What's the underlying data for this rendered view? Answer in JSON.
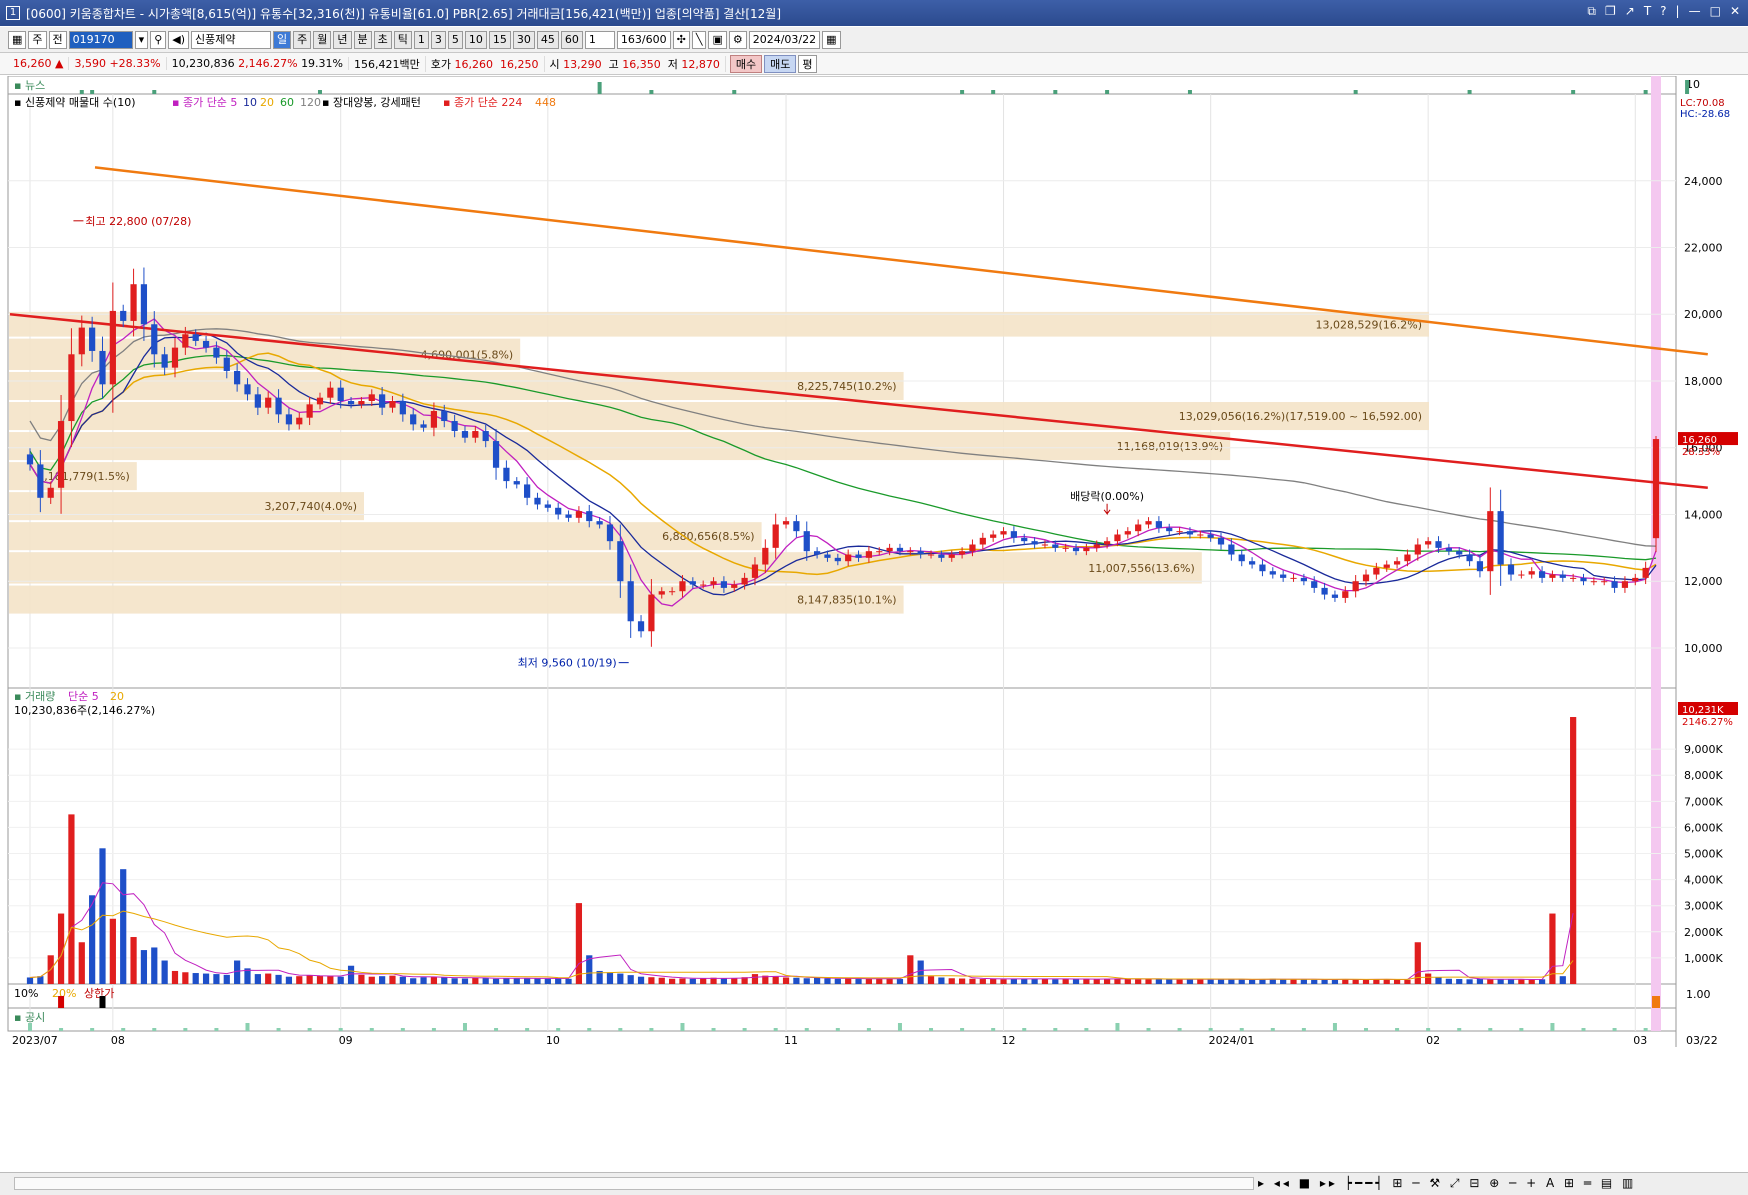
{
  "title": {
    "screen_num": "1",
    "text": "[0600] 키움종합차트 - 시가총액[8,615(억)] 유통수[32,316(천)] 유통비율[61.0] PBR[2.65] 거래대금[156,421(백만)] 업종[의약품] 결산[12월]"
  },
  "toolbar": {
    "type": "주",
    "range": "전",
    "code": "019170",
    "name": "신풍제약",
    "periods": [
      "일",
      "주",
      "월",
      "년",
      "분",
      "초",
      "틱"
    ],
    "active_period": "일",
    "intervals": [
      "1",
      "3",
      "5",
      "10",
      "15",
      "30",
      "45",
      "60"
    ],
    "multiplier": "1",
    "count": "163",
    "count_max": "/600",
    "date": "2024/03/22"
  },
  "quote": {
    "price": "16,260",
    "arrow": "▲",
    "change": "3,590",
    "change_pct": "+28.33%",
    "volume": "10,230,836",
    "vol_pct": "2,146.27%",
    "turnover": "19.31%",
    "amount": "156,421백만",
    "hoga_label": "호가",
    "ask": "16,260",
    "bid": "16,250",
    "open_label": "시",
    "open": "13,290",
    "high_label": "고",
    "high": "16,350",
    "low_label": "저",
    "low": "12,870",
    "buy": "매수",
    "sell": "매도",
    "p": "평"
  },
  "panels": {
    "news_label": "뉴스",
    "news_axis": "10",
    "price_legend": {
      "name": "신풍제약 매물대 수(10)",
      "ma_label": "종가 단순 5",
      "ma_periods": [
        "10",
        "20",
        "60",
        "120"
      ],
      "pattern": "장대양봉, 강세패턴",
      "long_ma_label": "종가 단순 224",
      "long_ma_2": "448"
    },
    "lc": "LC:70.08",
    "hc": "HC:-28.68",
    "price_tag": "16,260",
    "price_tag_pct": "28.33%",
    "volume_legend": "거래량",
    "volume_ma": "단순 5",
    "volume_ma2": "20",
    "volume_value": "10,230,836주(2,146.27%)",
    "volume_tag": "10,231K",
    "volume_tag_pct": "2146.27%",
    "limit_labels": [
      "10%",
      "20%",
      "상한가"
    ],
    "limit_axis": "1.00",
    "notice_label": "공시",
    "x_labels": [
      "2023/07",
      "08",
      "09",
      "10",
      "11",
      "12",
      "2024/01",
      "02",
      "03"
    ],
    "last_date": "03/22"
  },
  "colors": {
    "up": "#e01e1e",
    "down": "#1e4fc8",
    "ma5": "#c020c0",
    "ma10": "#1a2a9a",
    "ma20": "#e8a800",
    "ma60": "#1a9a2a",
    "ma120": "#808080",
    "ma224": "#e01e1e",
    "ma448": "#f07a10",
    "profile": "#f4e3c8",
    "highlight": "#f4c8f0"
  },
  "chart_data": {
    "type": "candlestick",
    "y_axis": {
      "min": 8800,
      "max": 26600,
      "ticks": [
        10000,
        12000,
        14000,
        16000,
        18000,
        20000,
        22000,
        24000
      ]
    },
    "volume_axis": {
      "max": 10231,
      "unit": "K",
      "ticks": [
        1000,
        2000,
        3000,
        4000,
        5000,
        6000,
        7000,
        8000,
        9000
      ]
    },
    "annotations": {
      "high": "최고 22,800 (07/28)",
      "low": "최저 9,560 (10/19)",
      "dividend": "배당락(0.00%)"
    },
    "volume_profile": [
      {
        "low": 19300,
        "high": 20100,
        "label": "13,028,529(16.2%)",
        "width": 1.0
      },
      {
        "low": 18300,
        "high": 19300,
        "label": "4,690,001(5.8%)",
        "width": 0.36
      },
      {
        "low": 17400,
        "high": 18300,
        "label": "8,225,745(10.2%)",
        "width": 0.63
      },
      {
        "low": 16500,
        "high": 17400,
        "label": "13,029,056(16.2%)(17,519.00 ~ 16,592.00)",
        "width": 1.0
      },
      {
        "low": 15600,
        "high": 16500,
        "label": "11,168,019(13.9%)",
        "width": 0.86
      },
      {
        "low": 14700,
        "high": 15600,
        "label": "1,181,779(1.5%)",
        "width": 0.09
      },
      {
        "low": 13800,
        "high": 14700,
        "label": "3,207,740(4.0%)",
        "width": 0.25
      },
      {
        "low": 12900,
        "high": 13800,
        "label": "6,880,656(8.5%)",
        "width": 0.53
      },
      {
        "low": 11900,
        "high": 12900,
        "label": "11,007,556(13.6%)",
        "width": 0.84
      },
      {
        "low": 11000,
        "high": 11900,
        "label": "8,147,835(10.1%)",
        "width": 0.63
      }
    ],
    "ma_long": {
      "ma224": [
        [
          0,
          20000
        ],
        [
          163,
          14800
        ]
      ],
      "ma448": [
        [
          9,
          24400
        ],
        [
          163,
          18800
        ]
      ]
    },
    "closes": [
      15500,
      14500,
      14800,
      16800,
      18800,
      19600,
      18900,
      17900,
      20100,
      19800,
      20900,
      19700,
      18800,
      18400,
      19000,
      19400,
      19200,
      19000,
      18700,
      18300,
      17900,
      17600,
      17200,
      17500,
      17000,
      16700,
      16900,
      17300,
      17500,
      17800,
      17400,
      17300,
      17400,
      17600,
      17200,
      17400,
      17000,
      16700,
      16600,
      17100,
      16800,
      16500,
      16300,
      16500,
      16200,
      15400,
      15000,
      14900,
      14500,
      14300,
      14200,
      14000,
      13900,
      14100,
      13800,
      13700,
      13200,
      12000,
      10800,
      10500,
      11600,
      11700,
      11700,
      12000,
      11900,
      11900,
      12000,
      11800,
      11900,
      12100,
      12500,
      13000,
      13700,
      13800,
      13500,
      12900,
      12800,
      12700,
      12600,
      12800,
      12700,
      12900,
      12900,
      13000,
      12900,
      12900,
      12800,
      12800,
      12700,
      12800,
      12900,
      13100,
      13300,
      13400,
      13500,
      13300,
      13200,
      13100,
      13100,
      13000,
      13000,
      12900,
      13000,
      13100,
      13200,
      13400,
      13500,
      13700,
      13800,
      13600,
      13500,
      13500,
      13400,
      13400,
      13300,
      13100,
      12800,
      12600,
      12500,
      12300,
      12200,
      12100,
      12100,
      12000,
      11800,
      11600,
      11500,
      11700,
      12000,
      12200,
      12400,
      12500,
      12600,
      12800,
      13100,
      13200,
      13000,
      12900,
      12800,
      12600,
      12300,
      14100,
      12500,
      12200,
      12200,
      12300,
      12100,
      12200,
      12100,
      12100,
      12000,
      12000,
      12000,
      11800,
      12000,
      12100,
      12400,
      16260
    ],
    "volume_K": [
      250,
      300,
      1100,
      2700,
      6500,
      1600,
      3400,
      5200,
      2500,
      4400,
      1800,
      1300,
      1400,
      900,
      500,
      450,
      420,
      400,
      380,
      350,
      900,
      600,
      380,
      400,
      350,
      280,
      300,
      330,
      320,
      300,
      280,
      700,
      350,
      280,
      300,
      320,
      280,
      220,
      260,
      280,
      250,
      220,
      210,
      240,
      240,
      200,
      220,
      210,
      230,
      220,
      200,
      210,
      200,
      3100,
      1100,
      500,
      450,
      400,
      340,
      280,
      260,
      240,
      200,
      210,
      200,
      220,
      240,
      210,
      220,
      260,
      380,
      320,
      280,
      250,
      240,
      220,
      230,
      210,
      200,
      220,
      190,
      200,
      210,
      200,
      190,
      1100,
      900,
      300,
      250,
      220,
      210,
      200,
      190,
      200,
      180,
      200,
      210,
      190,
      200,
      180,
      190,
      200,
      180,
      190,
      200,
      210,
      190,
      180,
      200,
      190,
      180,
      170,
      180,
      200,
      170,
      180,
      190,
      170,
      160,
      180,
      200,
      190,
      170,
      180,
      160,
      170,
      190,
      180,
      170,
      160,
      180,
      190,
      170,
      160,
      1600,
      400,
      250,
      200,
      190,
      180,
      200,
      170,
      180,
      190,
      170,
      160,
      180,
      2700,
      300,
      10231
    ]
  }
}
